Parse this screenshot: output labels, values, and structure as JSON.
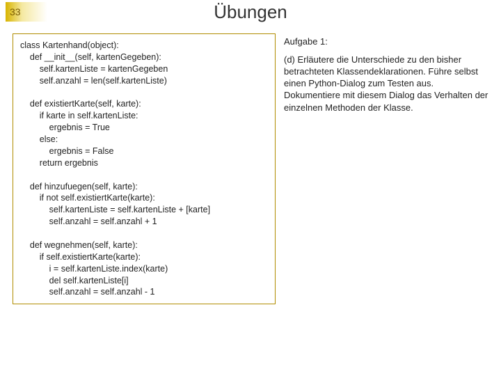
{
  "slide_number": "33",
  "title": "Übungen",
  "code": {
    "lines": [
      "class Kartenhand(object):",
      "    def __init__(self, kartenGegeben):",
      "        self.kartenListe = kartenGegeben",
      "        self.anzahl = len(self.kartenListe)",
      "",
      "    def existiertKarte(self, karte):",
      "        if karte in self.kartenListe:",
      "            ergebnis = True",
      "        else:",
      "            ergebnis = False",
      "        return ergebnis",
      "",
      "    def hinzufuegen(self, karte):",
      "        if not self.existiertKarte(karte):",
      "            self.kartenListe = self.kartenListe + [karte]",
      "            self.anzahl = self.anzahl + 1",
      "",
      "    def wegnehmen(self, karte):",
      "        if self.existiertKarte(karte):",
      "            i = self.kartenListe.index(karte)",
      "            del self.kartenListe[i]",
      "            self.anzahl = self.anzahl - 1"
    ]
  },
  "task": {
    "label": "Aufgabe 1:",
    "text": "(d) Erläutere die Unterschiede zu den bisher betrachteten Klassendeklarationen. Führe selbst einen Python-Dialog zum Testen aus. Dokumentiere mit diesem Dialog das Verhalten der einzelnen Methoden der Klasse."
  }
}
